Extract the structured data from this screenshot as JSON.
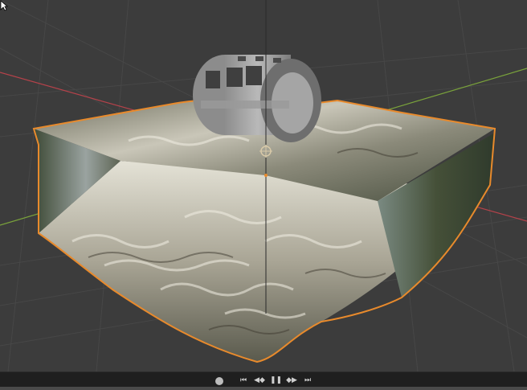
{
  "app": {
    "name": "3D Viewport"
  },
  "scene": {
    "objects": [
      "water-block",
      "wheel-mesh"
    ],
    "selected_outline_color": "#e88a2c",
    "grid_color": "#474747",
    "axis_x_color": "#b5424a",
    "axis_y_color": "#7aa33b"
  },
  "timeline": {
    "buttons": [
      {
        "name": "keyframe-dot-icon",
        "glyph": ""
      },
      {
        "name": "jump-start-icon",
        "glyph": "⏮"
      },
      {
        "name": "step-back-icon",
        "glyph": "◀◆"
      },
      {
        "name": "pause-icon",
        "glyph": "❚❚"
      },
      {
        "name": "step-forward-icon",
        "glyph": "◆▶"
      },
      {
        "name": "jump-end-icon",
        "glyph": "⏭"
      }
    ]
  }
}
